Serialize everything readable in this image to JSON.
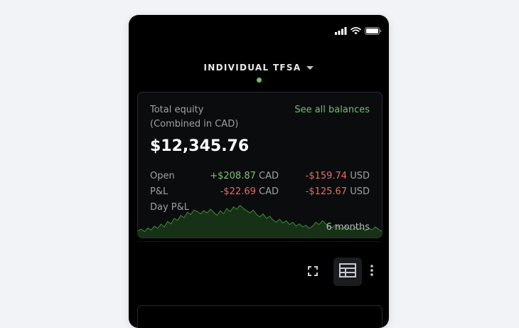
{
  "colors": {
    "positive": "#7fc37b",
    "negative": "#e76a63",
    "accent_green": "#6ac26b",
    "chart_line": "#3f8a3a",
    "chart_fill": "#173116"
  },
  "status_bar": {
    "icons": [
      "signal-icon",
      "wifi-icon",
      "battery-icon"
    ]
  },
  "account": {
    "name": "INDIVIDUAL TFSA",
    "selector_icon": "chevron-down-icon"
  },
  "balance": {
    "label_line1": "Total equity",
    "label_line2": "(Combined in CAD)",
    "see_all": "See all balances",
    "total": "$12,345.76",
    "rows": [
      {
        "label": "Open",
        "cad_value": "+$208.87",
        "cad_currency": "CAD",
        "usd_value": "-$159.74",
        "usd_currency": "USD"
      },
      {
        "label": "P&L",
        "cad_value": "-$22.69",
        "cad_currency": "CAD",
        "usd_value": "-$125.67",
        "usd_currency": "USD"
      }
    ],
    "third_row_label": "Day P&L",
    "period": "6 months"
  },
  "toolbar": {
    "icons": [
      "expand-icon",
      "table-view-icon",
      "more-vertical-icon"
    ]
  }
}
